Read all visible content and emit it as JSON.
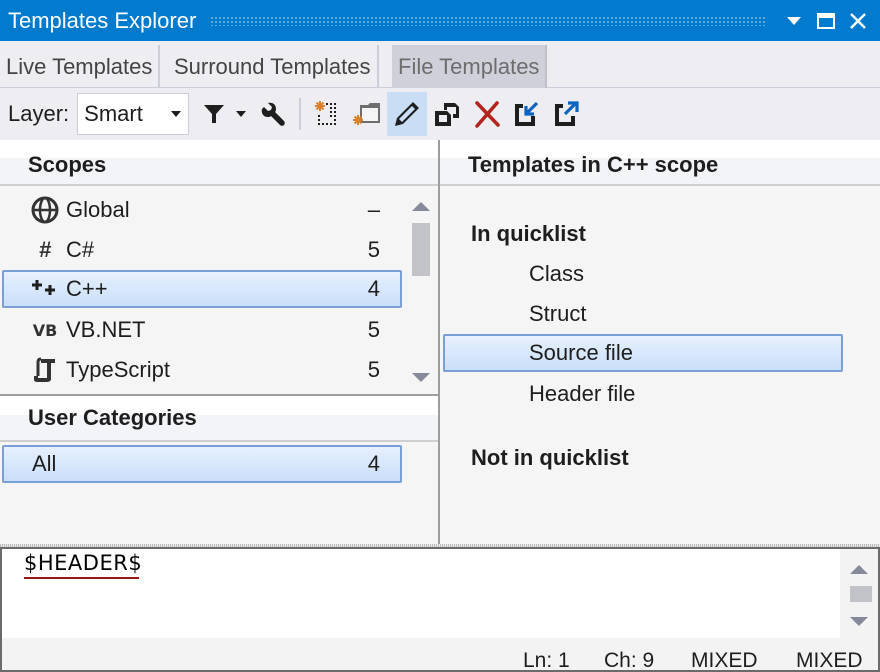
{
  "window": {
    "title": "Templates Explorer",
    "controls": [
      "dropdown",
      "maximize",
      "close"
    ]
  },
  "tabs": [
    {
      "label": "Live Templates",
      "active": false
    },
    {
      "label": "Surround Templates",
      "active": false
    },
    {
      "label": "File Templates",
      "active": true
    }
  ],
  "toolbar": {
    "layer_label": "Layer:",
    "layer_value": "Smart",
    "buttons": [
      {
        "name": "filter",
        "icon": "filter-icon"
      },
      {
        "name": "settings",
        "icon": "wrench-icon"
      },
      {
        "name": "new-template",
        "icon": "new-template-icon"
      },
      {
        "name": "new-template-in-folder",
        "icon": "new-folder-icon"
      },
      {
        "name": "edit",
        "icon": "pencil-icon",
        "pressed": true
      },
      {
        "name": "copy",
        "icon": "copy-icon"
      },
      {
        "name": "delete",
        "icon": "delete-icon"
      },
      {
        "name": "import",
        "icon": "import-icon"
      },
      {
        "name": "export",
        "icon": "export-icon"
      }
    ]
  },
  "scopes": {
    "header": "Scopes",
    "items": [
      {
        "icon": "globe-icon",
        "name": "Global",
        "count": "–"
      },
      {
        "icon": "hash-icon",
        "name": "C#",
        "count": "5"
      },
      {
        "icon": "cpp-icon",
        "name": "C++",
        "count": "4",
        "selected": true
      },
      {
        "icon": "vb-icon",
        "name": "VB.NET",
        "count": "5"
      },
      {
        "icon": "script-icon",
        "name": "TypeScript",
        "count": "5"
      }
    ]
  },
  "user_categories": {
    "header": "User Categories",
    "items": [
      {
        "name": "All",
        "count": "4",
        "selected": true
      }
    ]
  },
  "templates": {
    "header": "Templates in C++ scope",
    "in_quicklist_label": "In quicklist",
    "in_quicklist": [
      {
        "name": "Class"
      },
      {
        "name": "Struct"
      },
      {
        "name": "Source file",
        "selected": true
      },
      {
        "name": "Header file"
      }
    ],
    "not_in_quicklist_label": "Not in quicklist",
    "not_in_quicklist": []
  },
  "editor": {
    "content": "$HEADER$",
    "status": {
      "line": "Ln: 1",
      "char": "Ch: 9",
      "mode1": "MIXED",
      "mode2": "MIXED"
    }
  },
  "colors": {
    "titlebar": "#007acc",
    "selection_border": "#7a9fd6",
    "delete_red": "#b3261e",
    "accent_blue": "#0b64c0",
    "asterisk_orange": "#d9822b"
  }
}
